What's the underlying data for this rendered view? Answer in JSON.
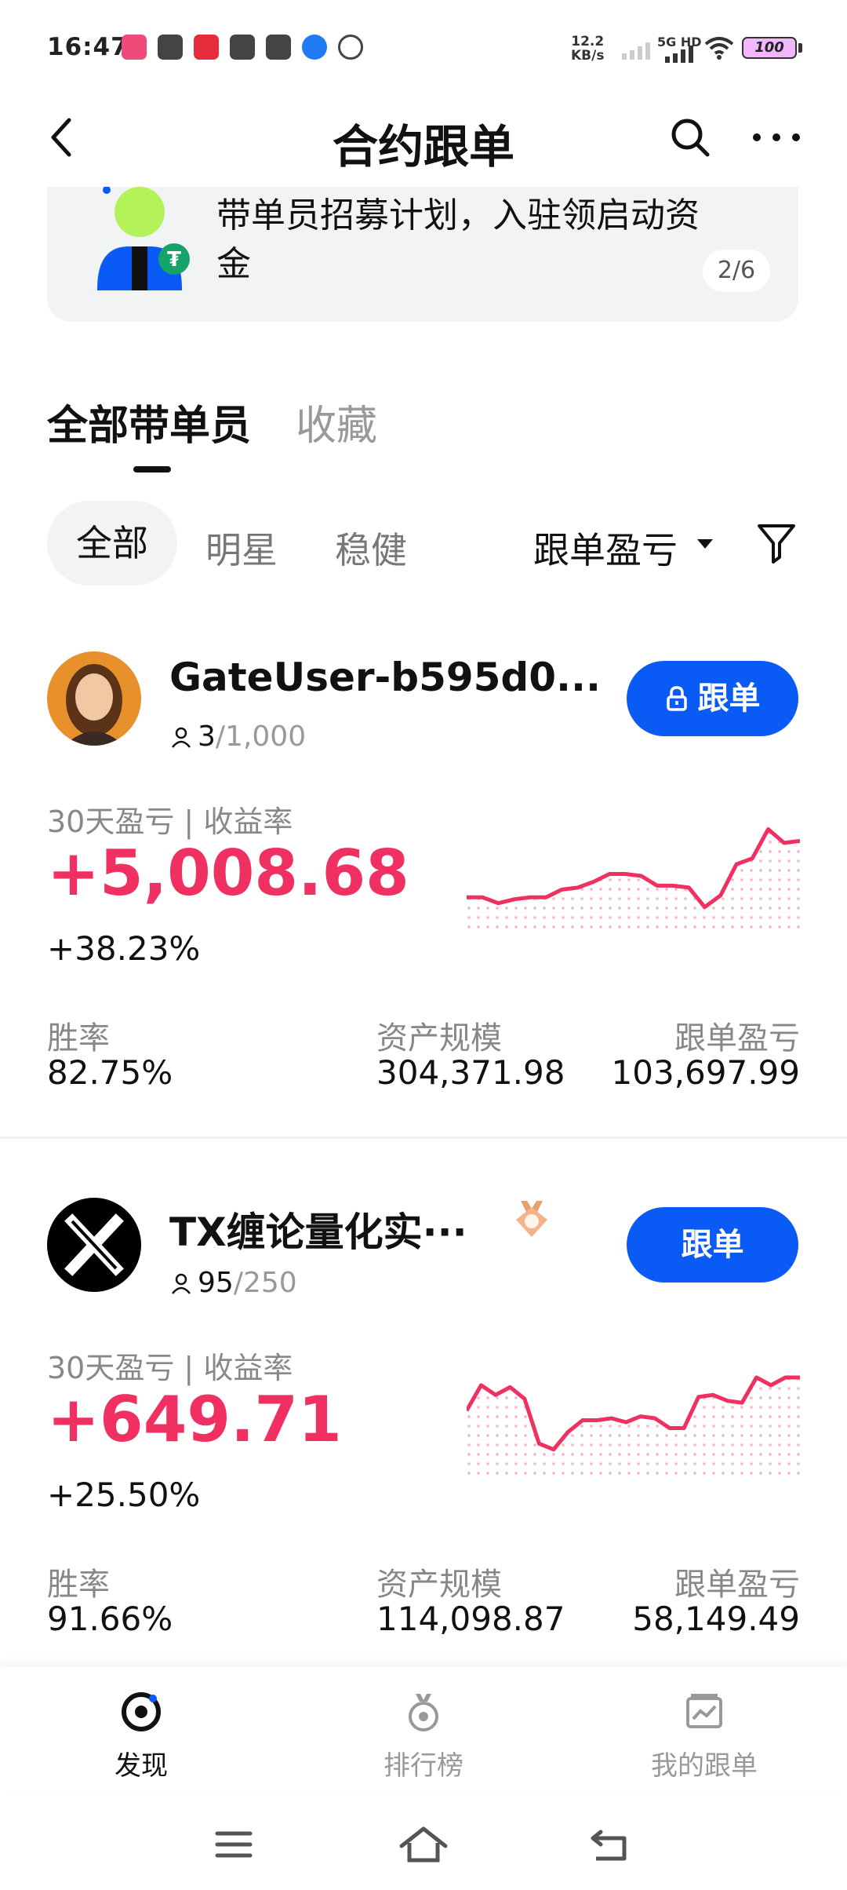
{
  "status_bar": {
    "time": "16:47",
    "net_speed_value": "12.2",
    "net_speed_unit": "KB/s",
    "net_type": "5G HD",
    "battery": "100"
  },
  "header": {
    "title": "合约跟单",
    "back_icon": "chevron-left-icon",
    "search_icon": "search-icon",
    "more_icon": "more-dots-icon"
  },
  "banner": {
    "text": "带单员招募计划，入驻领启动资金",
    "page_indicator": "2/6"
  },
  "tabs": [
    {
      "label": "全部带单员",
      "active": true
    },
    {
      "label": "收藏",
      "active": false
    }
  ],
  "filters": {
    "chips": [
      {
        "label": "全部",
        "active": true
      },
      {
        "label": "明星",
        "active": false
      },
      {
        "label": "稳健",
        "active": false
      }
    ],
    "sort_label": "跟单盈亏"
  },
  "traders": [
    {
      "name": "GateUser-b595d0...",
      "followers": "3",
      "capacity": "/1,000",
      "button_label": "跟单",
      "locked": true,
      "pnl_label": "30天盈亏 | 收益率",
      "pnl": "+5,008.68",
      "roi": "+38.23%",
      "stats": [
        {
          "label": "胜率",
          "value": "82.75%"
        },
        {
          "label": "资产规模",
          "value": "304,371.98"
        },
        {
          "label": "跟单盈亏",
          "value": "103,697.99"
        }
      ],
      "spark": [
        0.28,
        0.28,
        0.22,
        0.26,
        0.28,
        0.28,
        0.36,
        0.38,
        0.44,
        0.52,
        0.52,
        0.5,
        0.4,
        0.4,
        0.38,
        0.18,
        0.3,
        0.62,
        0.68,
        0.98,
        0.84,
        0.86
      ]
    },
    {
      "name": "TX缠论量化实···",
      "followers": "95",
      "capacity": "/250",
      "button_label": "跟单",
      "locked": false,
      "pnl_label": "30天盈亏 | 收益率",
      "pnl": "+649.71",
      "roi": "+25.50%",
      "stats": [
        {
          "label": "胜率",
          "value": "91.66%"
        },
        {
          "label": "资产规模",
          "value": "114,098.87"
        },
        {
          "label": "跟单盈亏",
          "value": "58,149.49"
        }
      ],
      "spark": [
        0.62,
        0.88,
        0.78,
        0.86,
        0.74,
        0.28,
        0.22,
        0.4,
        0.52,
        0.52,
        0.54,
        0.5,
        0.56,
        0.54,
        0.44,
        0.44,
        0.76,
        0.78,
        0.72,
        0.7,
        0.96,
        0.88,
        0.96,
        0.96
      ]
    }
  ],
  "bottom_nav": [
    {
      "label": "发现",
      "icon": "discover-icon",
      "active": true
    },
    {
      "label": "排行榜",
      "icon": "leaderboard-icon",
      "active": false
    },
    {
      "label": "我的跟单",
      "icon": "my-copytrade-icon",
      "active": false
    }
  ],
  "colors": {
    "accent_blue": "#0a5af5",
    "profit_red": "#f03060"
  }
}
